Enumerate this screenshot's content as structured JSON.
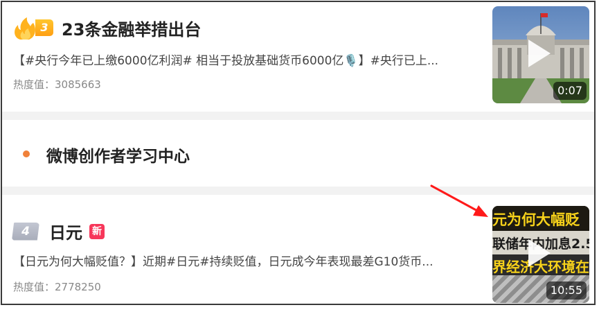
{
  "items": [
    {
      "rank": "3",
      "rank_style": "hot",
      "title": "23条金融举措出台",
      "summary": "【#央行今年已上缴6000亿利润# 相当于投放基础货币6000亿🎙️】#央行已上...",
      "heat": "热度值：3085663",
      "video_duration": "0:07"
    },
    {
      "rank": "4",
      "rank_style": "plain",
      "title": "日元",
      "badge": "新",
      "summary": "【日元为何大幅贬值？】近期#日元#持续贬值，日元成今年表现最差G10货币...",
      "heat": "热度值：2778250",
      "video_duration": "10:55",
      "thumb_text": [
        "元为何大幅贬",
        "联储年内加息2.5",
        "界经济大环境在变"
      ]
    }
  ],
  "section": {
    "title": "微博创作者学习中心"
  },
  "colors": {
    "hot_rank": "#ffaa1c",
    "plain_rank": "#b2b6c2",
    "new_badge": "#f7375a",
    "section_dot": "#f0813a",
    "annotation_arrow": "#ff1a1a"
  },
  "icons": [
    "flame-icon",
    "play-icon",
    "arrow-annotation-icon"
  ]
}
